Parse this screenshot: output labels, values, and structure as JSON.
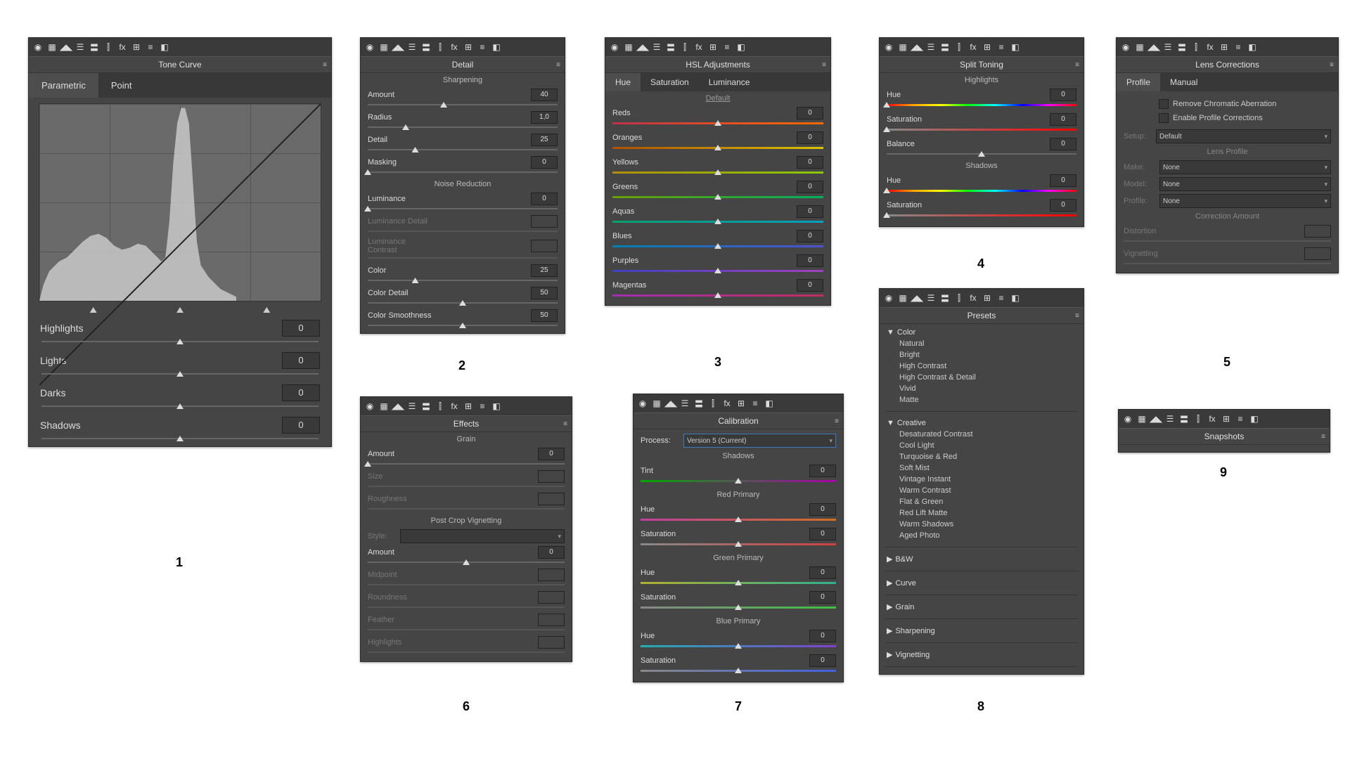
{
  "p1": {
    "title": "Tone Curve",
    "tabs": [
      "Parametric",
      "Point"
    ],
    "sliders": [
      {
        "l": "Highlights",
        "v": "0"
      },
      {
        "l": "Lights",
        "v": "0"
      },
      {
        "l": "Darks",
        "v": "0"
      },
      {
        "l": "Shadows",
        "v": "0"
      }
    ]
  },
  "p2": {
    "title": "Detail",
    "sharp": "Sharpening",
    "nr": "Noise Reduction",
    "s": [
      {
        "l": "Amount",
        "v": "40",
        "p": 40
      },
      {
        "l": "Radius",
        "v": "1,0",
        "p": 20
      },
      {
        "l": "Detail",
        "v": "25",
        "p": 25
      },
      {
        "l": "Masking",
        "v": "0",
        "p": 0
      }
    ],
    "n": [
      {
        "l": "Luminance",
        "v": "0",
        "p": 0
      },
      {
        "l": "Luminance Detail",
        "dim": 1
      },
      {
        "l": "Luminance Contrast",
        "dim": 1
      },
      {
        "l": "Color",
        "v": "25",
        "p": 25
      },
      {
        "l": "Color Detail",
        "v": "50",
        "p": 50
      },
      {
        "l": "Color Smoothness",
        "v": "50",
        "p": 50
      }
    ]
  },
  "p3": {
    "title": "HSL Adjustments",
    "tabs": [
      "Hue",
      "Saturation",
      "Luminance"
    ],
    "def": "Default",
    "colors": [
      {
        "l": "Reds",
        "g": "linear-gradient(90deg,#c0304a,#ff6a00)"
      },
      {
        "l": "Oranges",
        "g": "linear-gradient(90deg,#b05000,#d9c400)"
      },
      {
        "l": "Yellows",
        "g": "linear-gradient(90deg,#b09000,#89c900)"
      },
      {
        "l": "Greens",
        "g": "linear-gradient(90deg,#6aa000,#00b060)"
      },
      {
        "l": "Aquas",
        "g": "linear-gradient(90deg,#00a070,#00a0c0)"
      },
      {
        "l": "Blues",
        "g": "linear-gradient(90deg,#0080b0,#5050d0)"
      },
      {
        "l": "Purples",
        "g": "linear-gradient(90deg,#4040c0,#a040c0)"
      },
      {
        "l": "Magentas",
        "g": "linear-gradient(90deg,#a030b0,#c03060)"
      }
    ]
  },
  "p4": {
    "title": "Split Toning",
    "hl": "Highlights",
    "sh": "Shadows",
    "s": [
      {
        "l": "Hue",
        "v": "0",
        "t": "hue"
      },
      {
        "l": "Saturation",
        "v": "0",
        "t": "sat"
      }
    ],
    "bal": {
      "l": "Balance",
      "v": "0"
    }
  },
  "p5": {
    "title": "Lens Corrections",
    "tabs": [
      "Profile",
      "Manual"
    ],
    "chk1": "Remove Chromatic Aberration",
    "chk2": "Enable Profile Corrections",
    "setup": "Setup:",
    "setupv": "Default",
    "lp": "Lens Profile",
    "make": "Make:",
    "model": "Model:",
    "profile": "Profile:",
    "none": "None",
    "ca": "Correction Amount",
    "dist": "Distortion",
    "vig": "Vignetting"
  },
  "p6": {
    "title": "Effects",
    "grain": "Grain",
    "pcv": "Post Crop Vignetting",
    "g": [
      {
        "l": "Amount",
        "v": "0"
      },
      {
        "l": "Size",
        "dim": 1
      },
      {
        "l": "Roughness",
        "dim": 1
      }
    ],
    "style": "Style:",
    "v": [
      {
        "l": "Amount",
        "v": "0"
      },
      {
        "l": "Midpoint",
        "dim": 1
      },
      {
        "l": "Roundness",
        "dim": 1
      },
      {
        "l": "Feather",
        "dim": 1
      },
      {
        "l": "Highlights",
        "dim": 1
      }
    ]
  },
  "p7": {
    "title": "Calibration",
    "proc": "Process:",
    "procv": "Version 5 (Current)",
    "sh": "Shadows",
    "tint": "Tint",
    "rp": "Red Primary",
    "gp": "Green Primary",
    "bp": "Blue Primary",
    "hue": "Hue",
    "sat": "Saturation",
    "zero": "0",
    "tintg": "linear-gradient(90deg,#0a0,#a0a)",
    "rhg": "linear-gradient(90deg,#c040a0,#d07020)",
    "rsg": "linear-gradient(90deg,#888,#d04040)",
    "ghg": "linear-gradient(90deg,#b0b030,#30b090)",
    "gsg": "linear-gradient(90deg,#888,#40c040)",
    "bhg": "linear-gradient(90deg,#20b0b0,#8040d0)",
    "bsg": "linear-gradient(90deg,#888,#4060e0)"
  },
  "p8": {
    "title": "Presets",
    "groups": [
      {
        "n": "Color",
        "open": 1,
        "items": [
          "Natural",
          "Bright",
          "High Contrast",
          "High Contrast & Detail",
          "Vivid",
          "Matte"
        ]
      },
      {
        "n": "Creative",
        "open": 1,
        "items": [
          "Desaturated Contrast",
          "Cool Light",
          "Turquoise & Red",
          "Soft Mist",
          "Vintage Instant",
          "Warm Contrast",
          "Flat & Green",
          "Red Lift Matte",
          "Warm Shadows",
          "Aged Photo"
        ]
      },
      {
        "n": "B&W"
      },
      {
        "n": "Curve"
      },
      {
        "n": "Grain"
      },
      {
        "n": "Sharpening"
      },
      {
        "n": "Vignetting"
      }
    ]
  },
  "p9": {
    "title": "Snapshots"
  },
  "nums": [
    "1",
    "2",
    "3",
    "4",
    "5",
    "6",
    "7",
    "8",
    "9"
  ]
}
